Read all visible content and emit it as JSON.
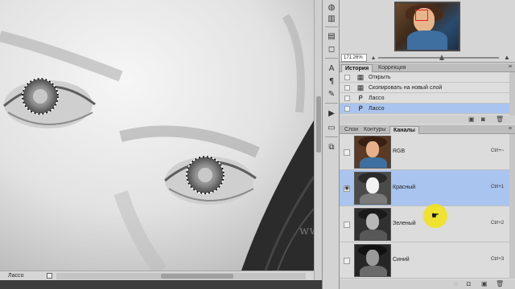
{
  "canvas": {
    "watermark": "www.photoshopsunduchok.ru"
  },
  "statusbar": {
    "tool_label": "Лассо"
  },
  "navigator": {
    "zoom": "171.26%",
    "zoom_out_icon": "small-mountain-icon",
    "zoom_in_icon": "large-mountain-icon"
  },
  "history": {
    "tabs": [
      "История",
      "Коррекция"
    ],
    "active_tab": "История",
    "items": [
      {
        "label": "Открыть",
        "icon": "document-icon",
        "selected": false
      },
      {
        "label": "Скопировать на новый слой",
        "icon": "document-icon",
        "selected": false
      },
      {
        "label": "Лассо",
        "icon": "lasso-icon",
        "selected": false
      },
      {
        "label": "Лассо",
        "icon": "lasso-icon",
        "selected": true
      }
    ]
  },
  "channels": {
    "tabs": [
      "Слои",
      "Контуры",
      "Каналы"
    ],
    "active_tab": "Каналы",
    "rows": [
      {
        "name": "RGB",
        "shortcut": "Ctrl+~",
        "selected": false,
        "visible": false,
        "style": "color"
      },
      {
        "name": "Красный",
        "shortcut": "Ctrl+1",
        "selected": true,
        "visible": true,
        "style": "bright"
      },
      {
        "name": "Зеленый",
        "shortcut": "Ctrl+2",
        "selected": false,
        "visible": false,
        "style": "mid"
      },
      {
        "name": "Синий",
        "shortcut": "Ctrl+3",
        "selected": false,
        "visible": false,
        "style": "dark"
      }
    ]
  },
  "colors": {
    "selection_highlight": "#a9c4ee",
    "cursor_highlight": "#f1e21e"
  }
}
